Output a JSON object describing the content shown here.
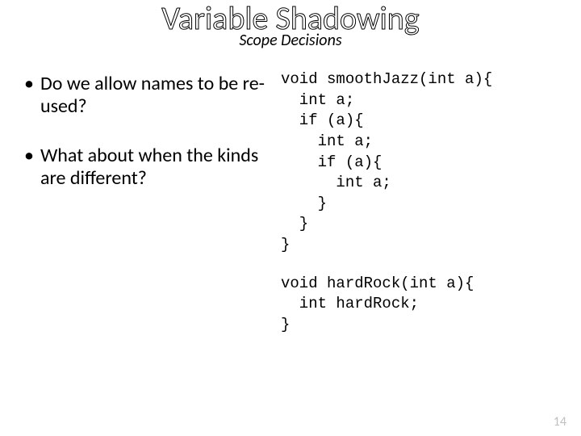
{
  "title": "Variable Shadowing",
  "subtitle": "Scope Decisions",
  "bullets": [
    "Do we allow names to be re-used?",
    "What about when the kinds are different?"
  ],
  "code1": "void smoothJazz(int a){\n  int a;\n  if (a){\n    int a;\n    if (a){\n      int a;\n    }\n  }\n}",
  "code2": "void hardRock(int a){\n  int hardRock;\n}",
  "page_number": "14"
}
